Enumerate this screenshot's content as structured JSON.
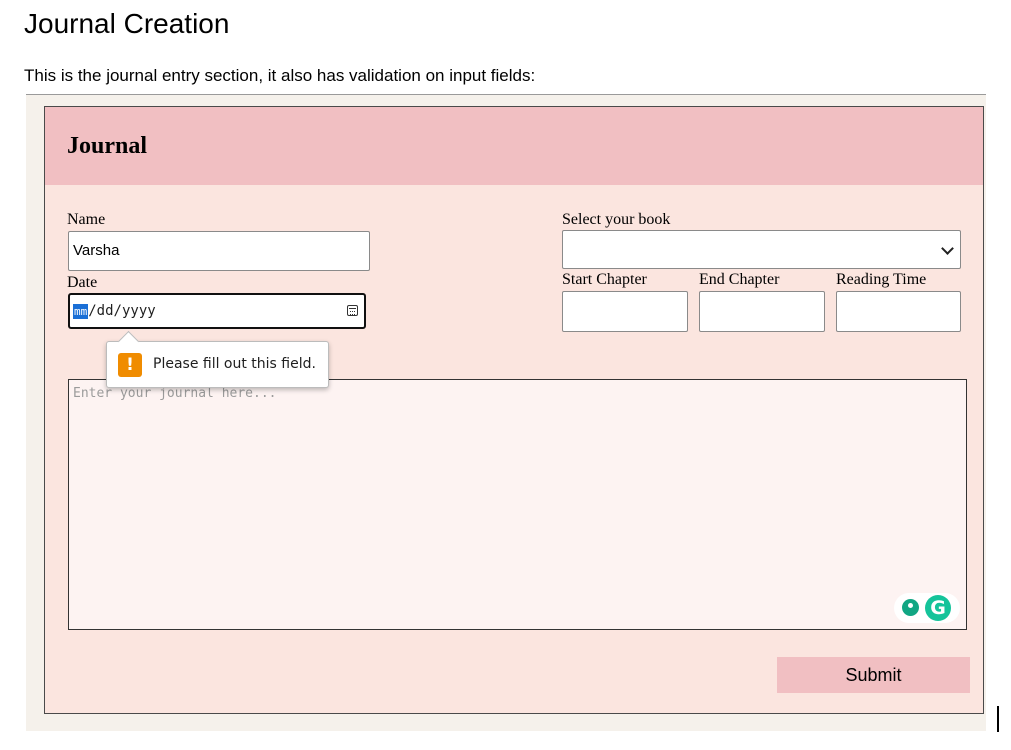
{
  "doc": {
    "title": "Journal Creation",
    "intro": "This is the journal entry section, it also has validation on input fields:"
  },
  "card": {
    "title": "Journal"
  },
  "form": {
    "name_label": "Name",
    "name_value": "Varsha",
    "date_label": "Date",
    "date_active_segment": "mm",
    "date_rest": "/dd/yyyy",
    "book_label": "Select your book",
    "book_selected": "",
    "start_chapter_label": "Start Chapter",
    "end_chapter_label": "End Chapter",
    "reading_time_label": "Reading Time",
    "journal_placeholder": "Enter your journal here...",
    "submit_label": "Submit"
  },
  "validation": {
    "message": "Please fill out this field.",
    "icon_glyph": "!"
  },
  "grammarly": {
    "g_glyph": "G"
  },
  "colors": {
    "header_pink": "#f1bfc2",
    "card_bg": "#fbe5df",
    "textarea_bg": "#fdf3f2",
    "warning_orange": "#f08c00",
    "date_highlight": "#1a6fd6",
    "grammarly_green": "#15c39a"
  }
}
